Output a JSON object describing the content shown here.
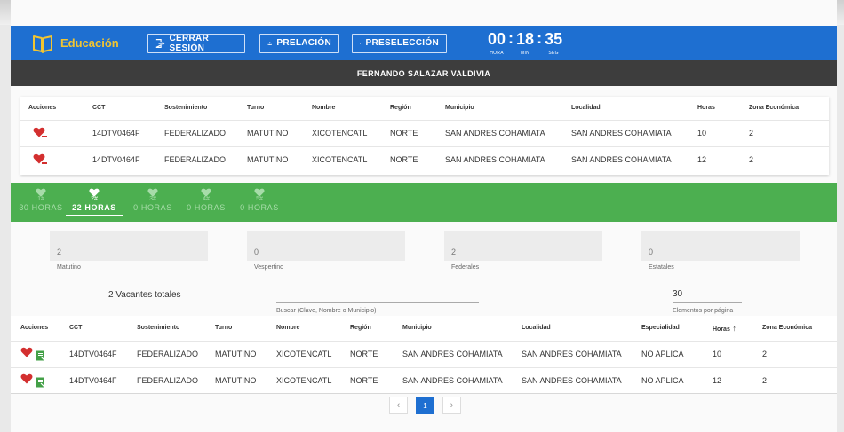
{
  "header": {
    "brand": "Educación",
    "logout_label": "CERRAR SESIÓN",
    "prelacion_label": "PRELACIÓN",
    "preseleccion_label": "PRESELECCIÓN",
    "clock": {
      "hours": "00",
      "minutes": "18",
      "seconds": "35",
      "hours_unit": "HORA",
      "minutes_unit": "MIN",
      "seconds_unit": "SEG"
    },
    "accent_color": "#1e6fd1",
    "brand_color": "#f2c531"
  },
  "user": {
    "name": "FERNANDO SALAZAR VALDIVIA"
  },
  "selected_table": {
    "columns": [
      "Acciones",
      "CCT",
      "Sostenimiento",
      "Turno",
      "Nombre",
      "Región",
      "Municipio",
      "Localidad",
      "Horas",
      "Zona Económica"
    ],
    "rows": [
      [
        "",
        "14DTV0464F",
        "FEDERALIZADO",
        "MATUTINO",
        "XICOTENCATL",
        "NORTE",
        "SAN ANDRES COHAMIATA",
        "SAN ANDRES COHAMIATA",
        "10",
        "2"
      ],
      [
        "",
        "14DTV0464F",
        "FEDERALIZADO",
        "MATUTINO",
        "XICOTENCATL",
        "NORTE",
        "SAN ANDRES COHAMIATA",
        "SAN ANDRES COHAMIATA",
        "12",
        "2"
      ]
    ]
  },
  "tabs": [
    {
      "num": "1#",
      "hours": "30 HORAS"
    },
    {
      "num": "2#",
      "hours": "22 HORAS"
    },
    {
      "num": "3#",
      "hours": "0 HORAS"
    },
    {
      "num": "4#",
      "hours": "0 HORAS"
    },
    {
      "num": "5#",
      "hours": "0 HORAS"
    }
  ],
  "active_tab": 1,
  "stats": [
    {
      "value": "2",
      "label": "Matutino"
    },
    {
      "value": "0",
      "label": "Vespertino"
    },
    {
      "value": "2",
      "label": "Federales"
    },
    {
      "value": "0",
      "label": "Estatales"
    }
  ],
  "vacantes_label": "2 Vacantes totales",
  "search": {
    "value": "",
    "label": "Buscar (Clave, Nombre o Municipio)"
  },
  "per_page": {
    "value": "30",
    "label": "Elementos por página"
  },
  "vacancy_table": {
    "columns": [
      "Acciones",
      "CCT",
      "Sostenimiento",
      "Turno",
      "Nombre",
      "Región",
      "Municipio",
      "Localidad",
      "Especialidad",
      "Horas",
      "Zona Económica"
    ],
    "rows": [
      [
        "",
        "14DTV0464F",
        "FEDERALIZADO",
        "MATUTINO",
        "XICOTENCATL",
        "NORTE",
        "SAN ANDRES COHAMIATA",
        "SAN ANDRES COHAMIATA",
        "NO APLICA",
        "10",
        "2"
      ],
      [
        "",
        "14DTV0464F",
        "FEDERALIZADO",
        "MATUTINO",
        "XICOTENCATL",
        "NORTE",
        "SAN ANDRES COHAMIATA",
        "SAN ANDRES COHAMIATA",
        "NO APLICA",
        "12",
        "2"
      ]
    ]
  },
  "pagination": {
    "prev": "‹",
    "current": "1",
    "next": "›"
  }
}
